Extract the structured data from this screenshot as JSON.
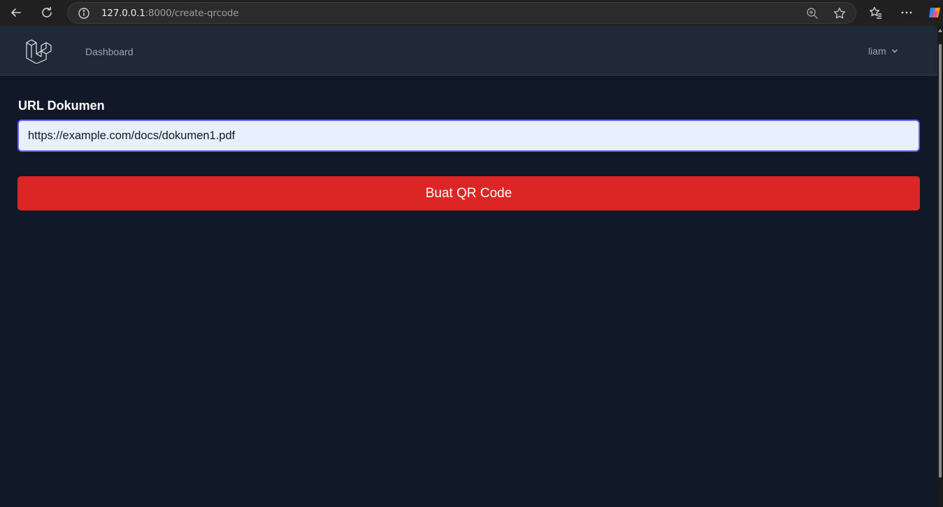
{
  "browser": {
    "url_host": "127.0.0.1",
    "url_rest": ":8000/create-qrcode"
  },
  "nav": {
    "dashboard_label": "Dashboard",
    "user_name": "liam"
  },
  "form": {
    "label": "URL Dokumen",
    "url_value": "https://example.com/docs/dokumen1.pdf",
    "submit_label": "Buat QR Code"
  },
  "colors": {
    "page_bg": "#111827",
    "nav_bg": "#1f2937",
    "button_bg": "#dc2626",
    "input_border": "#6366f1",
    "input_bg": "#e8f0fe"
  },
  "icons": {
    "back": "arrow-left-icon",
    "reload": "reload-icon",
    "site_info": "info-icon",
    "zoom": "zoom-icon",
    "favorite": "star-icon",
    "favorites_bar": "favorites-icon",
    "more": "more-icon",
    "copilot": "copilot-icon",
    "logo": "laravel-logo-icon",
    "user_menu": "chevron-down-icon"
  }
}
